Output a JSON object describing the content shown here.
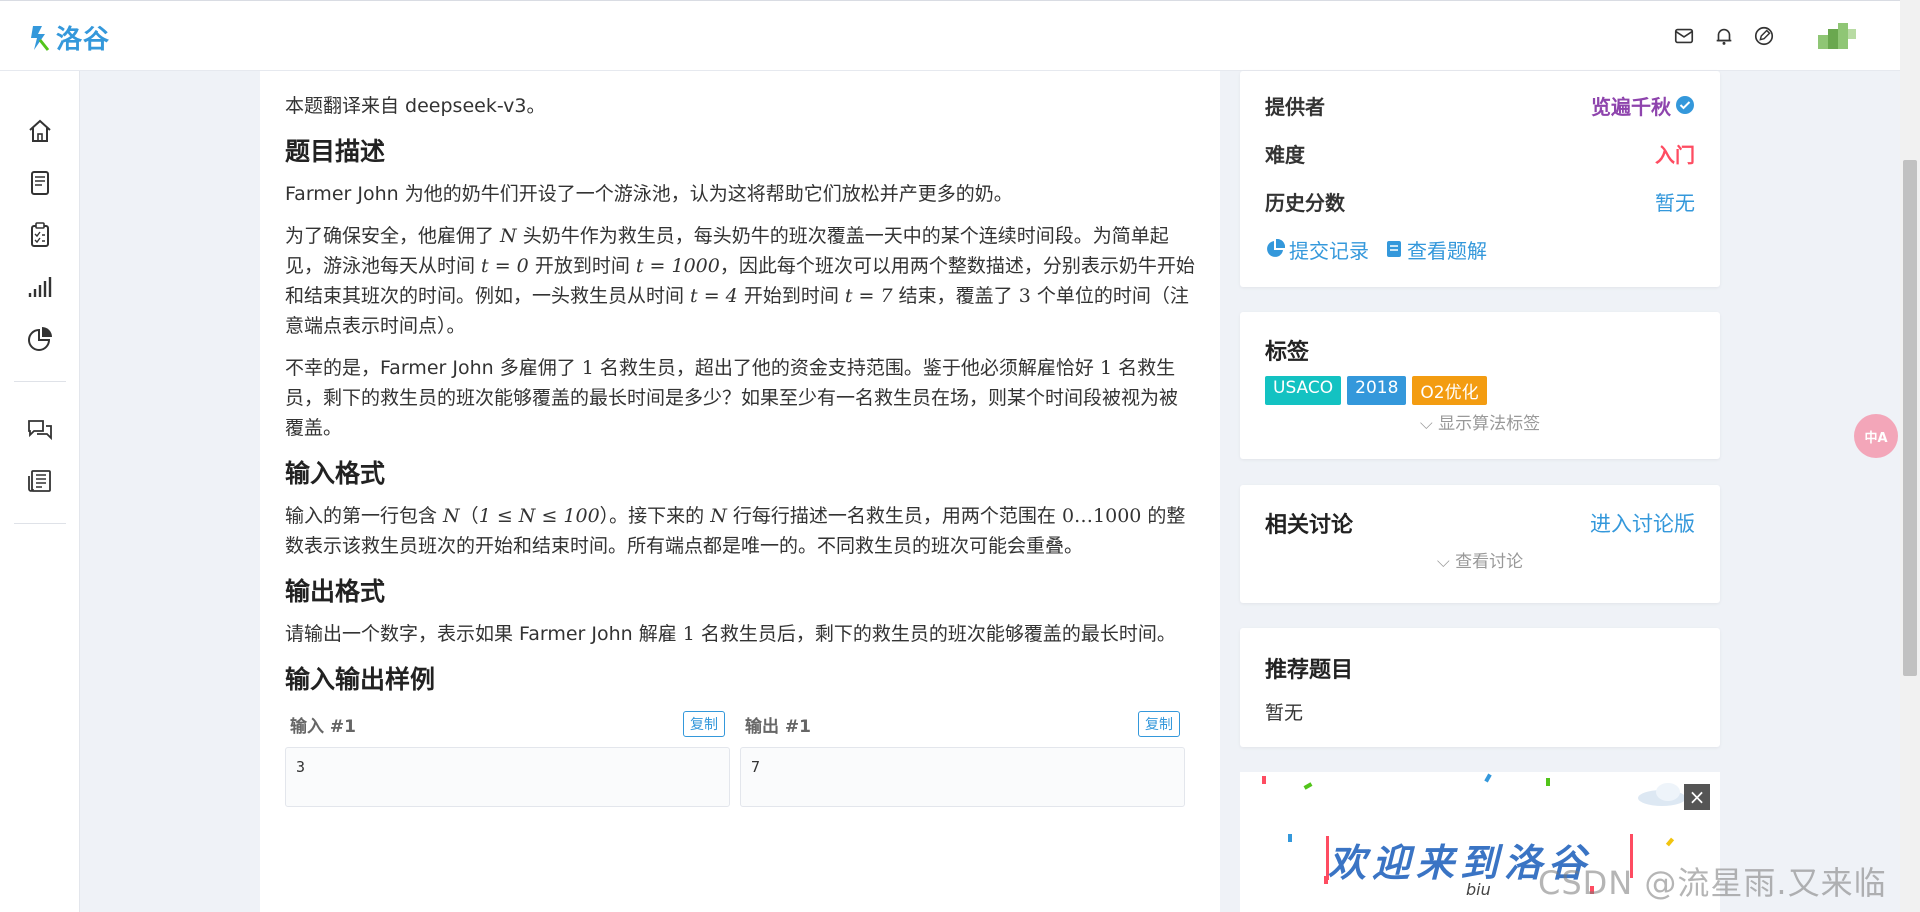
{
  "brand": {
    "logo_text": "洛谷"
  },
  "topbar": {
    "icons": [
      "mail-icon",
      "bell-icon",
      "edit-icon",
      "user-avatar"
    ]
  },
  "sidebar": {
    "items": [
      "home-icon",
      "book-icon",
      "clipboard-icon",
      "signal-bars-icon",
      "pie-chart-icon",
      "chat-icon",
      "newspaper-icon"
    ]
  },
  "article": {
    "intro": "本题翻译来自 deepseek-v3。",
    "desc_heading": "题目描述",
    "desc_p1": "Farmer John 为他的奶牛们开设了一个游泳池，认为这将帮助它们放松并产更多的奶。",
    "desc_p2": {
      "a": "为了确保安全，他雇佣了 ",
      "m1": "N",
      "b": " 头奶牛作为救生员，每头奶牛的班次覆盖一天中的某个连续时间段。为简单起见，游泳池每天从时间 ",
      "m2": "t = 0",
      "c": " 开放到时间 ",
      "m3": "t = 1000",
      "d": "，因此每个班次可以用两个整数描述，分别表示奶牛开始和结束其班次的时间。例如，一头救生员从时间 ",
      "m4": "t = 4",
      "e": " 开始到时间 ",
      "m5": "t = 7",
      "f": " 结束，覆盖了 ",
      "m6": "3",
      "g": " 个单位的时间（注意端点表示时间点）。"
    },
    "desc_p3": {
      "a": "不幸的是，Farmer John 多雇佣了 ",
      "m1": "1",
      "b": " 名救生员，超出了他的资金支持范围。鉴于他必须解雇恰好 ",
      "m2": "1",
      "c": " 名救生员，剩下的救生员的班次能够覆盖的最长时间是多少？如果至少有一名救生员在场，则某个时间段被视为被覆盖。"
    },
    "input_heading": "输入格式",
    "input_p": {
      "a": "输入的第一行包含 ",
      "m1": "N",
      "b": "（",
      "m2": "1 ≤ N ≤ 100",
      "c": "）。接下来的 ",
      "m3": "N",
      "d": " 行每行描述一名救生员，用两个范围在 ",
      "m4": "0…1000",
      "e": " 的整数表示该救生员班次的开始和结束时间。所有端点都是唯一的。不同救生员的班次可能会重叠。"
    },
    "output_heading": "输出格式",
    "output_p": {
      "a": "请输出一个数字，表示如果 Farmer John 解雇 ",
      "m1": "1",
      "b": " 名救生员后，剩下的救生员的班次能够覆盖的最长时间。"
    },
    "samples_heading": "输入输出样例",
    "sample_input_title": "输入 #1",
    "sample_output_title": "输出 #1",
    "copy_label": "复制",
    "sample_input_value": "3",
    "sample_output_value": "7"
  },
  "info_card": {
    "provider_label": "提供者",
    "provider_value": "览遍千秋",
    "difficulty_label": "难度",
    "difficulty_value": "入门",
    "score_label": "历史分数",
    "score_value": "暂无",
    "submissions_link": "提交记录",
    "solutions_link": "查看题解"
  },
  "tags_card": {
    "title": "标签",
    "tags": [
      {
        "label": "USACO",
        "color": "#13c2c2"
      },
      {
        "label": "2018",
        "color": "#3498db"
      },
      {
        "label": "O2优化",
        "color": "#f39c11"
      }
    ],
    "expand_label": "显示算法标签"
  },
  "discussion_card": {
    "title": "相关讨论",
    "enter_link": "进入讨论版",
    "expand_label": "查看讨论"
  },
  "recommend_card": {
    "title": "推荐题目",
    "value": "暂无"
  },
  "banner": {
    "text": "欢迎来到洛谷",
    "small_text": "biu"
  },
  "translate_button": {
    "label": "中A"
  },
  "watermark": "CSDN @流星雨.又来临",
  "colors": {
    "accent": "#3498db",
    "difficulty": "#fe4c61",
    "provider": "#8e44ad"
  }
}
